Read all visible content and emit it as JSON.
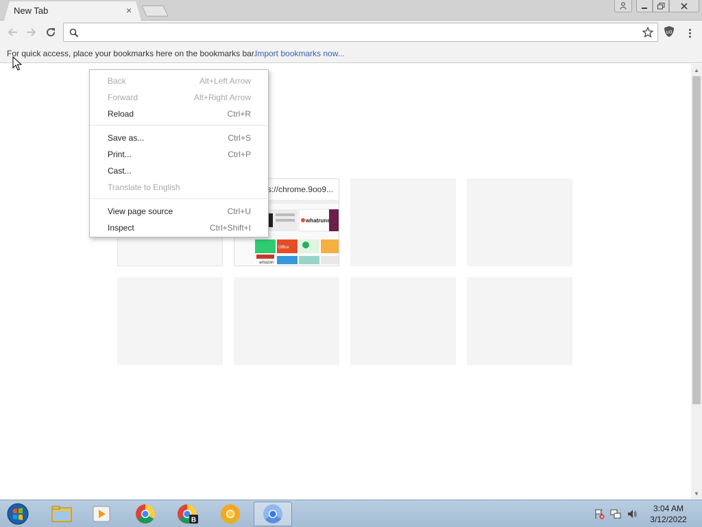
{
  "colors": {
    "tabstrip_bg": "#d2d2d2",
    "toolbar_bg": "#f2f2f2",
    "link": "#3b5fb3",
    "menu_disabled_text": "#a8a8a8",
    "taskbar_bg": "#b9cde0"
  },
  "tab": {
    "title": "New Tab",
    "close_icon": "×"
  },
  "window_controls": {
    "user_icon": "user-icon",
    "minimize_icon": "minimize-icon",
    "maximize_icon": "restore-icon",
    "close_icon": "close-icon"
  },
  "toolbar": {
    "back_icon": "arrow-left-icon",
    "forward_icon": "arrow-right-icon",
    "reload_icon": "reload-icon",
    "omnibox_value": "",
    "search_icon": "search-icon",
    "bookmark_icon": "star-icon",
    "extension_icon": "ublock-shield-icon",
    "menu_icon": "vertical-dots-icon"
  },
  "bookmarks_bar": {
    "message": "For quick access, place your bookmarks here on the bookmarks bar.",
    "import_link": "Import bookmarks now..."
  },
  "most_visited": {
    "tiles": [
      {
        "title": "",
        "has_thumbnail": false
      },
      {
        "title": "https://chrome.9oo9...",
        "has_thumbnail": true
      },
      {
        "title": "",
        "has_thumbnail": false
      },
      {
        "title": "",
        "has_thumbnail": false
      },
      {
        "title": "",
        "has_thumbnail": false
      },
      {
        "title": "",
        "has_thumbnail": false
      },
      {
        "title": "",
        "has_thumbnail": false
      },
      {
        "title": "",
        "has_thumbnail": false
      }
    ],
    "thumbnail_texts": [
      "whatruns",
      "Office",
      "amazon"
    ]
  },
  "context_menu": {
    "items": [
      {
        "label": "Back",
        "shortcut": "Alt+Left Arrow",
        "disabled": true
      },
      {
        "label": "Forward",
        "shortcut": "Alt+Right Arrow",
        "disabled": true
      },
      {
        "label": "Reload",
        "shortcut": "Ctrl+R",
        "disabled": false
      },
      {
        "label": "Save as...",
        "shortcut": "Ctrl+S",
        "disabled": false
      },
      {
        "label": "Print...",
        "shortcut": "Ctrl+P",
        "disabled": false
      },
      {
        "label": "Cast...",
        "shortcut": "",
        "disabled": false
      },
      {
        "label": "Translate to English",
        "shortcut": "",
        "disabled": true
      },
      {
        "label": "View page source",
        "shortcut": "Ctrl+U",
        "disabled": false
      },
      {
        "label": "Inspect",
        "shortcut": "Ctrl+Shift+I",
        "disabled": false
      }
    ]
  },
  "taskbar": {
    "start_icon": "windows-start-icon",
    "apps": [
      {
        "name": "file-explorer-icon",
        "active": false
      },
      {
        "name": "media-player-icon",
        "active": false
      },
      {
        "name": "chrome-icon",
        "active": false
      },
      {
        "name": "chrome-profile-b-icon",
        "active": false,
        "badge": "B"
      },
      {
        "name": "chrome-canary-icon",
        "active": false
      },
      {
        "name": "chromium-icon",
        "active": true
      }
    ],
    "tray_icons": [
      "action-center-flag-icon",
      "network-icon",
      "volume-icon"
    ],
    "clock_time": "3:04 AM",
    "clock_date": "3/12/2022"
  }
}
